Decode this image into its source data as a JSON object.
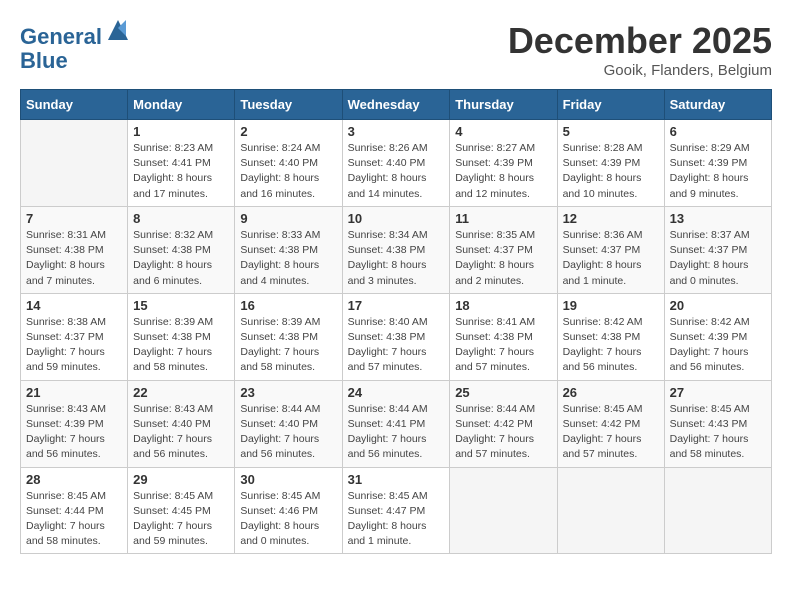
{
  "header": {
    "logo_line1": "General",
    "logo_line2": "Blue",
    "month": "December 2025",
    "location": "Gooik, Flanders, Belgium"
  },
  "weekdays": [
    "Sunday",
    "Monday",
    "Tuesday",
    "Wednesday",
    "Thursday",
    "Friday",
    "Saturday"
  ],
  "weeks": [
    [
      {
        "num": "",
        "info": ""
      },
      {
        "num": "1",
        "info": "Sunrise: 8:23 AM\nSunset: 4:41 PM\nDaylight: 8 hours\nand 17 minutes."
      },
      {
        "num": "2",
        "info": "Sunrise: 8:24 AM\nSunset: 4:40 PM\nDaylight: 8 hours\nand 16 minutes."
      },
      {
        "num": "3",
        "info": "Sunrise: 8:26 AM\nSunset: 4:40 PM\nDaylight: 8 hours\nand 14 minutes."
      },
      {
        "num": "4",
        "info": "Sunrise: 8:27 AM\nSunset: 4:39 PM\nDaylight: 8 hours\nand 12 minutes."
      },
      {
        "num": "5",
        "info": "Sunrise: 8:28 AM\nSunset: 4:39 PM\nDaylight: 8 hours\nand 10 minutes."
      },
      {
        "num": "6",
        "info": "Sunrise: 8:29 AM\nSunset: 4:39 PM\nDaylight: 8 hours\nand 9 minutes."
      }
    ],
    [
      {
        "num": "7",
        "info": "Sunrise: 8:31 AM\nSunset: 4:38 PM\nDaylight: 8 hours\nand 7 minutes."
      },
      {
        "num": "8",
        "info": "Sunrise: 8:32 AM\nSunset: 4:38 PM\nDaylight: 8 hours\nand 6 minutes."
      },
      {
        "num": "9",
        "info": "Sunrise: 8:33 AM\nSunset: 4:38 PM\nDaylight: 8 hours\nand 4 minutes."
      },
      {
        "num": "10",
        "info": "Sunrise: 8:34 AM\nSunset: 4:38 PM\nDaylight: 8 hours\nand 3 minutes."
      },
      {
        "num": "11",
        "info": "Sunrise: 8:35 AM\nSunset: 4:37 PM\nDaylight: 8 hours\nand 2 minutes."
      },
      {
        "num": "12",
        "info": "Sunrise: 8:36 AM\nSunset: 4:37 PM\nDaylight: 8 hours\nand 1 minute."
      },
      {
        "num": "13",
        "info": "Sunrise: 8:37 AM\nSunset: 4:37 PM\nDaylight: 8 hours\nand 0 minutes."
      }
    ],
    [
      {
        "num": "14",
        "info": "Sunrise: 8:38 AM\nSunset: 4:37 PM\nDaylight: 7 hours\nand 59 minutes."
      },
      {
        "num": "15",
        "info": "Sunrise: 8:39 AM\nSunset: 4:38 PM\nDaylight: 7 hours\nand 58 minutes."
      },
      {
        "num": "16",
        "info": "Sunrise: 8:39 AM\nSunset: 4:38 PM\nDaylight: 7 hours\nand 58 minutes."
      },
      {
        "num": "17",
        "info": "Sunrise: 8:40 AM\nSunset: 4:38 PM\nDaylight: 7 hours\nand 57 minutes."
      },
      {
        "num": "18",
        "info": "Sunrise: 8:41 AM\nSunset: 4:38 PM\nDaylight: 7 hours\nand 57 minutes."
      },
      {
        "num": "19",
        "info": "Sunrise: 8:42 AM\nSunset: 4:38 PM\nDaylight: 7 hours\nand 56 minutes."
      },
      {
        "num": "20",
        "info": "Sunrise: 8:42 AM\nSunset: 4:39 PM\nDaylight: 7 hours\nand 56 minutes."
      }
    ],
    [
      {
        "num": "21",
        "info": "Sunrise: 8:43 AM\nSunset: 4:39 PM\nDaylight: 7 hours\nand 56 minutes."
      },
      {
        "num": "22",
        "info": "Sunrise: 8:43 AM\nSunset: 4:40 PM\nDaylight: 7 hours\nand 56 minutes."
      },
      {
        "num": "23",
        "info": "Sunrise: 8:44 AM\nSunset: 4:40 PM\nDaylight: 7 hours\nand 56 minutes."
      },
      {
        "num": "24",
        "info": "Sunrise: 8:44 AM\nSunset: 4:41 PM\nDaylight: 7 hours\nand 56 minutes."
      },
      {
        "num": "25",
        "info": "Sunrise: 8:44 AM\nSunset: 4:42 PM\nDaylight: 7 hours\nand 57 minutes."
      },
      {
        "num": "26",
        "info": "Sunrise: 8:45 AM\nSunset: 4:42 PM\nDaylight: 7 hours\nand 57 minutes."
      },
      {
        "num": "27",
        "info": "Sunrise: 8:45 AM\nSunset: 4:43 PM\nDaylight: 7 hours\nand 58 minutes."
      }
    ],
    [
      {
        "num": "28",
        "info": "Sunrise: 8:45 AM\nSunset: 4:44 PM\nDaylight: 7 hours\nand 58 minutes."
      },
      {
        "num": "29",
        "info": "Sunrise: 8:45 AM\nSunset: 4:45 PM\nDaylight: 7 hours\nand 59 minutes."
      },
      {
        "num": "30",
        "info": "Sunrise: 8:45 AM\nSunset: 4:46 PM\nDaylight: 8 hours\nand 0 minutes."
      },
      {
        "num": "31",
        "info": "Sunrise: 8:45 AM\nSunset: 4:47 PM\nDaylight: 8 hours\nand 1 minute."
      },
      {
        "num": "",
        "info": ""
      },
      {
        "num": "",
        "info": ""
      },
      {
        "num": "",
        "info": ""
      }
    ]
  ]
}
